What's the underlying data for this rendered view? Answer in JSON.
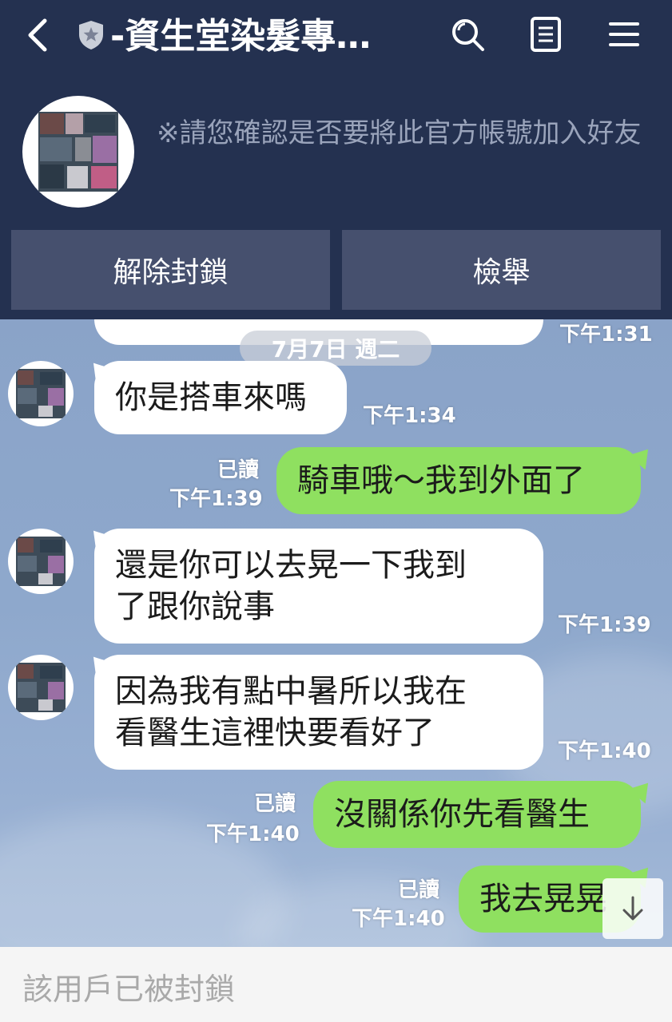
{
  "header": {
    "title": "-資生堂染髮專…",
    "notice": "※請您確認是否要將此官方帳號加入好友",
    "unblock_label": "解除封鎖",
    "report_label": "檢舉"
  },
  "chat": {
    "date_label": "7月7日 週二",
    "partial_top_time": "下午1:31",
    "messages": [
      {
        "side": "in",
        "text_lines": [
          "你是搭車來嗎"
        ],
        "time": "下午1:34"
      },
      {
        "side": "out",
        "text_lines": [
          "騎車哦～我到外面了"
        ],
        "read": "已讀",
        "time": "下午1:39"
      },
      {
        "side": "in",
        "text_lines": [
          "還是你可以去晃一下我到",
          "了跟你說事"
        ],
        "time": "下午1:39"
      },
      {
        "side": "in",
        "text_lines": [
          "因為我有點中暑所以我在",
          "看醫生這裡快要看好了"
        ],
        "time": "下午1:40"
      },
      {
        "side": "out",
        "text_lines": [
          "沒關係你先看醫生"
        ],
        "read": "已讀",
        "time": "下午1:40"
      },
      {
        "side": "out",
        "text_lines": [
          "我去晃晃"
        ],
        "read": "已讀",
        "time": "下午1:40"
      }
    ]
  },
  "footer": {
    "blocked_text": "該用戶已被封鎖"
  },
  "icons": {
    "back": "chevron-left-icon",
    "badge": "shield-star-icon",
    "search": "search-icon",
    "notes": "notes-icon",
    "menu": "hamburger-menu-icon",
    "scroll": "arrow-down-icon"
  },
  "colors": {
    "header_bg": "#243150",
    "outgoing_bubble": "#8fe060",
    "incoming_bubble": "#ffffff"
  }
}
